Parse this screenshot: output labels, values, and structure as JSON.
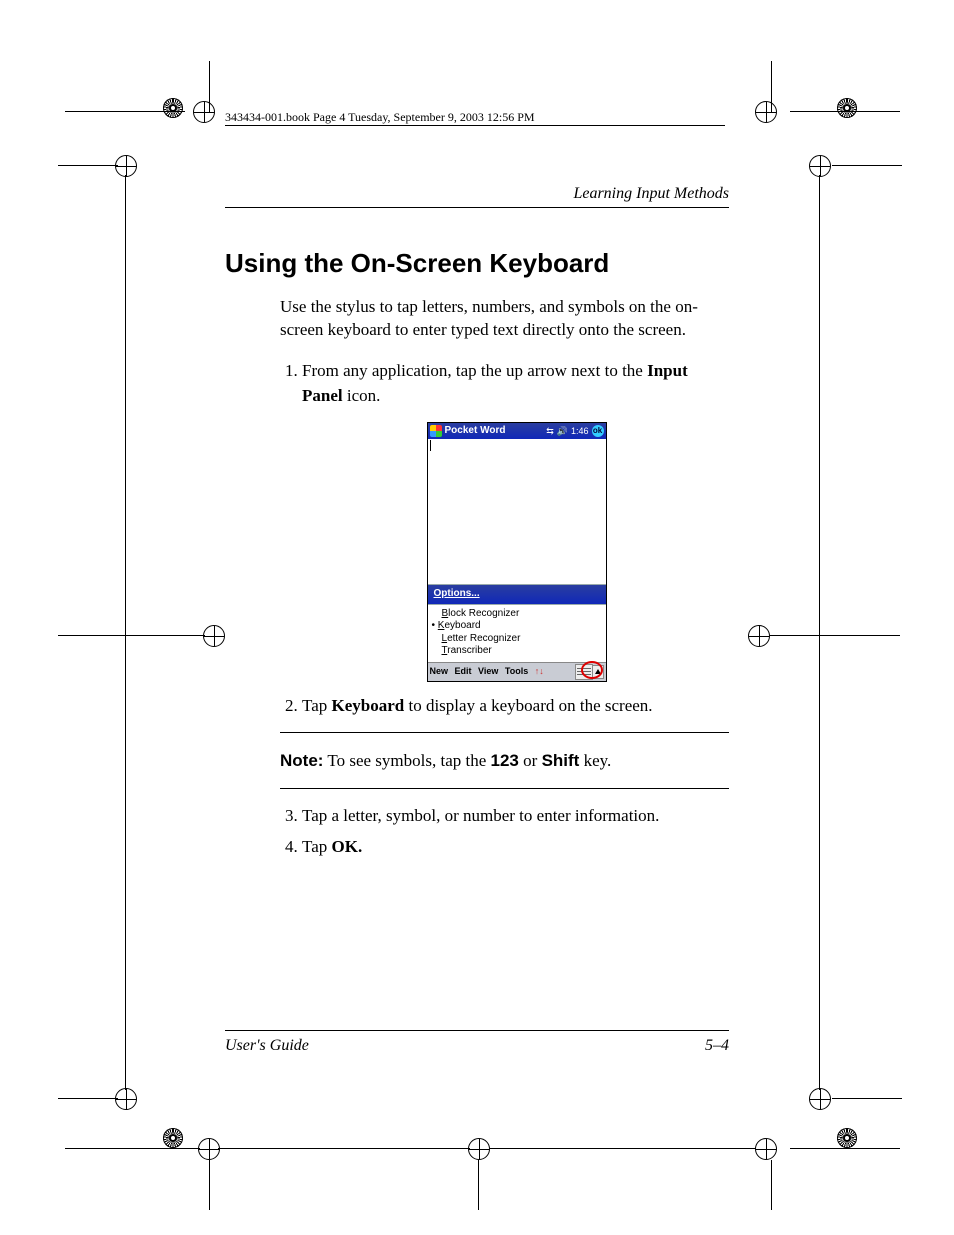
{
  "header": {
    "book_info": "343434-001.book  Page 4  Tuesday, September 9, 2003  12:56 PM"
  },
  "section": {
    "label": "Learning Input Methods"
  },
  "heading": "Using the On-Screen Keyboard",
  "intro": "Use the stylus to tap letters, numbers, and symbols on the on-screen keyboard to enter typed text directly onto the screen.",
  "steps": {
    "s1_pre": "From any application, tap the up arrow next to the ",
    "s1_bold": "Input Panel",
    "s1_post": " icon.",
    "s2_pre": "Tap ",
    "s2_bold": "Keyboard",
    "s2_post": " to display a keyboard on the screen.",
    "s3": "Tap a letter, symbol, or number to enter information.",
    "s4_pre": "Tap ",
    "s4_bold": "OK."
  },
  "note": {
    "label": "Note:",
    "pre": " To see symbols, tap the ",
    "k123": "123",
    "mid": " or ",
    "kshift": "Shift",
    "post": " key."
  },
  "footer": {
    "left": "User's Guide",
    "right": "5–4"
  },
  "pda": {
    "title": "Pocket Word",
    "time": "1:46",
    "ok": "ok",
    "options": "Options...",
    "menu": {
      "block": "Block Recognizer",
      "keyboard": "Keyboard",
      "letter": "Letter Recognizer",
      "transcriber": "Transcriber"
    },
    "bottom": {
      "new": "New",
      "edit": "Edit",
      "view": "View",
      "tools": "Tools"
    }
  }
}
